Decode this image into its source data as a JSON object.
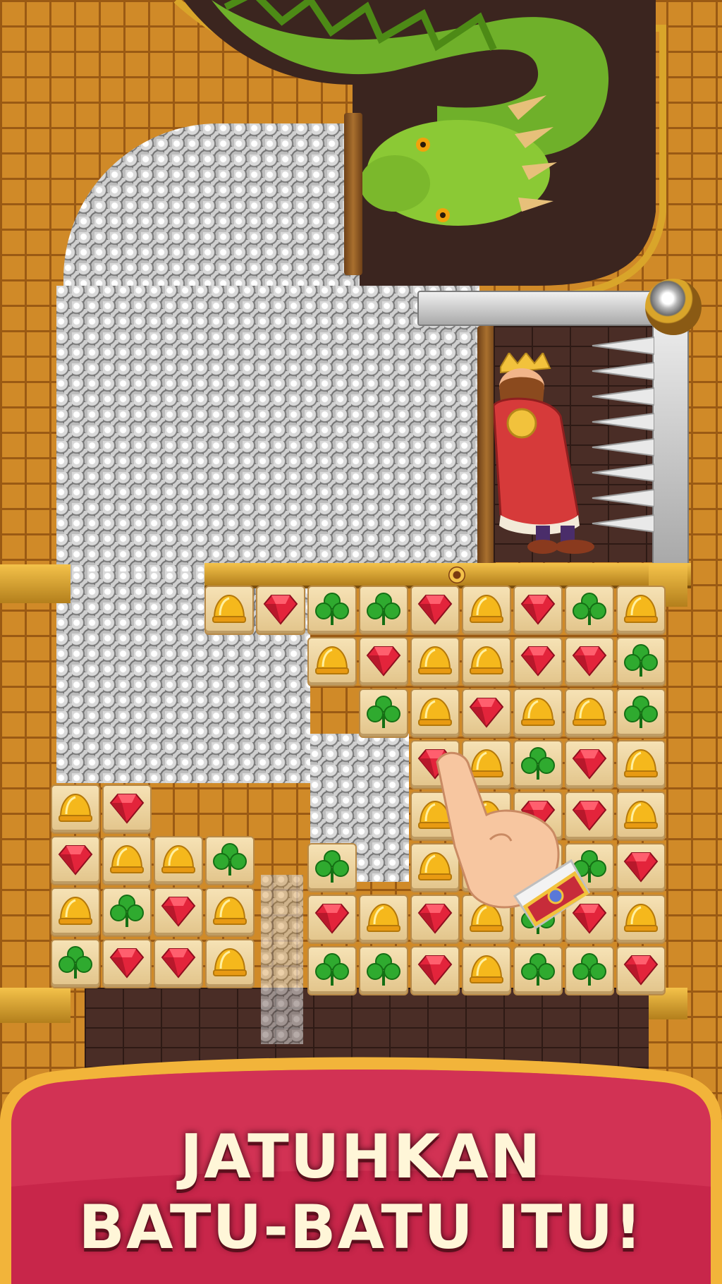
{
  "banner": {
    "line1": "JATUHKAN",
    "line2": "BATU-BATU ITU!"
  },
  "colors": {
    "brick": "#d08a28",
    "mortar": "#9a5a14",
    "banner_red": "#c8264a",
    "banner_gold": "#f2b43a",
    "text_cream": "#fff6d8"
  },
  "icons": {
    "helmet": "gold-helmet-icon",
    "gem": "red-gem-icon",
    "clover": "green-clover-icon"
  },
  "board": {
    "rows": [
      {
        "start": 0,
        "tiles": [
          "helmet",
          "gem",
          "clover",
          "clover",
          "gem",
          "helmet",
          "gem",
          "clover",
          "helmet"
        ]
      },
      {
        "start": 2,
        "tiles": [
          "helmet",
          "gem",
          "helmet",
          "helmet",
          "gem",
          "gem",
          "clover"
        ]
      },
      {
        "start": 3,
        "tiles": [
          "clover",
          "helmet",
          "gem",
          "helmet",
          "helmet",
          "clover"
        ]
      },
      {
        "start": 4,
        "tiles": [
          "gem",
          "helmet",
          "clover",
          "gem",
          "helmet"
        ]
      },
      {
        "start": 4,
        "tiles": [
          "helmet",
          "helmet",
          "gem",
          "gem",
          "helmet"
        ]
      },
      {
        "start": 4,
        "tiles": [
          "helmet",
          "helmet",
          "clover",
          "clover",
          "gem"
        ]
      },
      {
        "start": 2,
        "tiles": [
          "gem",
          "helmet",
          "gem",
          "helmet",
          "clover",
          "gem",
          "helmet"
        ]
      },
      {
        "start": 2,
        "tiles": [
          "clover",
          "clover",
          "gem",
          "helmet",
          "clover",
          "clover",
          "gem"
        ]
      }
    ],
    "left_block": [
      {
        "start": 0,
        "tiles": [
          "helmet",
          "gem"
        ]
      },
      {
        "start": 0,
        "tiles": [
          "gem",
          "helmet",
          "helmet",
          "clover"
        ]
      },
      {
        "start": 0,
        "tiles": [
          "helmet",
          "clover",
          "gem",
          "helmet"
        ]
      },
      {
        "start": 0,
        "tiles": [
          "clover",
          "gem",
          "gem",
          "helmet"
        ]
      }
    ],
    "mid_tile": {
      "tile": "clover"
    }
  }
}
